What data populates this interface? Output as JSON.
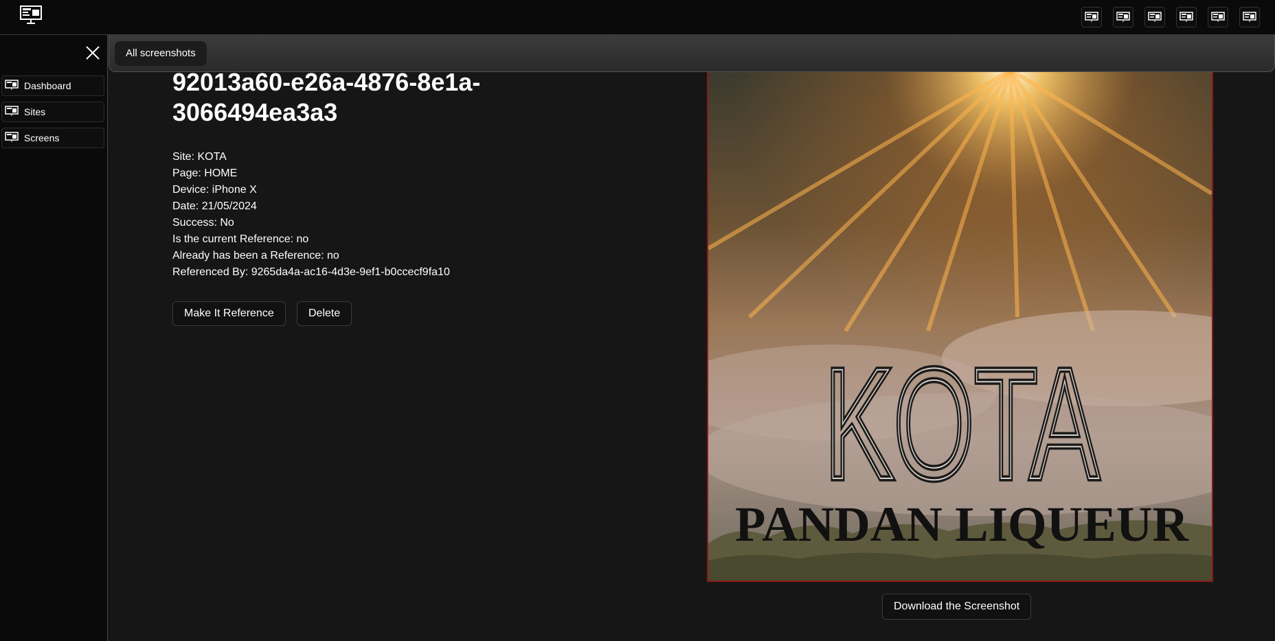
{
  "topbar": {
    "logo_icon": "monitor-icon",
    "action_icons": [
      "monitor-icon",
      "monitor-icon",
      "monitor-icon",
      "monitor-icon",
      "monitor-icon",
      "monitor-icon"
    ]
  },
  "sidebar": {
    "close_icon": "close-icon",
    "items": [
      {
        "label": "Dashboard",
        "icon": "monitor-icon"
      },
      {
        "label": "Sites",
        "icon": "monitor-icon"
      },
      {
        "label": "Screens",
        "icon": "monitor-icon"
      }
    ]
  },
  "toolbar": {
    "all_screenshots_label": "All screenshots"
  },
  "screenshot": {
    "id_line1": "92013a60-e26a-4876-8e1a-",
    "id_line2": "3066494ea3a3",
    "details": [
      "Site: KOTA",
      "Page: HOME",
      "Device: iPhone X",
      "Date: 21/05/2024",
      "Success: No",
      "Is the current Reference: no",
      "Already has been a Reference: no",
      "Referenced By: 9265da4a-ac16-4d3e-9ef1-b0ccecf9fa10"
    ],
    "make_reference_label": "Make It Reference",
    "delete_label": "Delete",
    "download_label": "Download the Screenshot",
    "image_brand": "KOTA",
    "image_tagline": "PANDAN LIQUEUR",
    "image_border_color": "#8a1a1a"
  }
}
